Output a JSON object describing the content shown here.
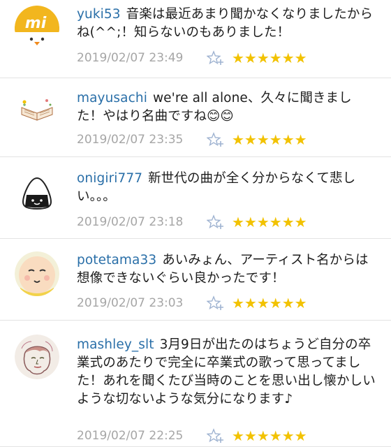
{
  "comments": [
    {
      "user": "yuki53",
      "body": "音楽は最近あまり聞かなくなりましたからね(^^;！知らないのもありました！",
      "time": "2019/02/07 23:49",
      "avatar": "mi-logo-avatar"
    },
    {
      "user": "mayusachi",
      "body": "we're all alone、久々に聞きました！やはり名曲ですね😊😊",
      "time": "2019/02/07 23:35",
      "avatar": "book-avatar"
    },
    {
      "user": "onigiri777",
      "body": "新世代の曲が全く分からなくて悲しい。。。",
      "time": "2019/02/07 23:18",
      "avatar": "onigiri-avatar"
    },
    {
      "user": "potetama33",
      "body": "あいみょん、アーティスト名からは想像できないぐらい良かったです！",
      "time": "2019/02/07 23:03",
      "avatar": "face-avatar"
    },
    {
      "user": "mashley_slt",
      "body": "3月9日が出たのはちょうど自分の卒業式のあたりで完全に卒業式の歌って思ってました！あれを聞くたび当時のことを思い出し懐かしいような切ないような気分になります♪",
      "time": "2019/02/07 22:25",
      "avatar": "sketch-avatar"
    }
  ],
  "stars": "★★★★★★",
  "colors": {
    "username": "#2a6fa8",
    "timestamp": "#a6a6a6",
    "star": "#f2c200",
    "fav_icon": "#9fb3d1"
  },
  "icons": {
    "fav": "star-plus-icon"
  }
}
